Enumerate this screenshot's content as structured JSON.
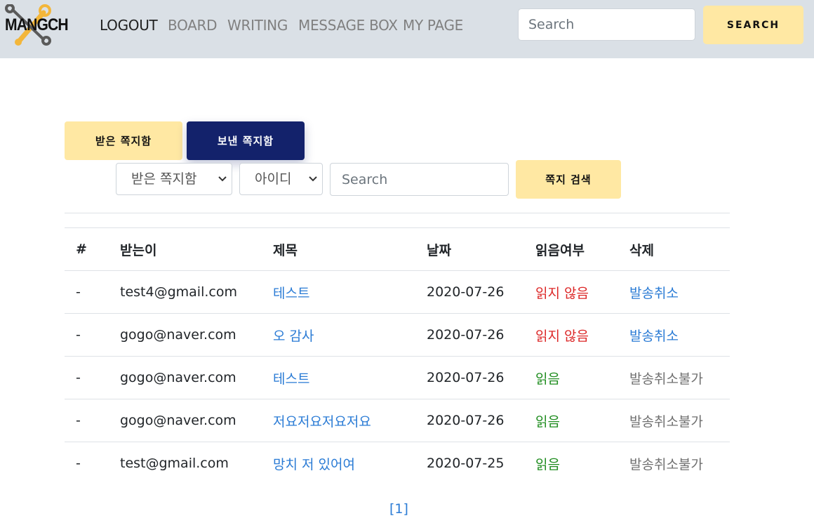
{
  "brand": {
    "logo_text": "MANGCH"
  },
  "nav": {
    "links": [
      {
        "label": "LOGOUT"
      },
      {
        "label": "BOARD"
      },
      {
        "label": "WRITING"
      },
      {
        "label": "MESSAGE BOX"
      },
      {
        "label": "MY PAGE"
      }
    ],
    "search_placeholder": "Search",
    "search_button": "SEARCH"
  },
  "tabs": {
    "received": "받은 쪽지함",
    "sent": "보낸 쪽지함"
  },
  "filter": {
    "box_select": "받은 쪽지함",
    "field_select": "아이디",
    "search_placeholder": "Search",
    "search_button": "쪽지 검색"
  },
  "table": {
    "headers": {
      "index": "#",
      "recipient": "받는이",
      "title": "제목",
      "date": "날짜",
      "read": "읽음여부",
      "delete": "삭제"
    },
    "rows": [
      {
        "index": "-",
        "recipient": "test4@gmail.com",
        "title": "테스트",
        "date": "2020-07-26",
        "read": "읽지 않음",
        "delete": "발송취소"
      },
      {
        "index": "-",
        "recipient": "gogo@naver.com",
        "title": "오 감사",
        "date": "2020-07-26",
        "read": "읽지 않음",
        "delete": "발송취소"
      },
      {
        "index": "-",
        "recipient": "gogo@naver.com",
        "title": "테스트",
        "date": "2020-07-26",
        "read": "읽음",
        "delete": "발송취소불가"
      },
      {
        "index": "-",
        "recipient": "gogo@naver.com",
        "title": "저요저요저요저요",
        "date": "2020-07-26",
        "read": "읽음",
        "delete": "발송취소불가"
      },
      {
        "index": "-",
        "recipient": "test@gmail.com",
        "title": "망치 저 있어여",
        "date": "2020-07-25",
        "read": "읽음",
        "delete": "발송취소불가"
      }
    ]
  },
  "pagination": {
    "current": "[1]"
  },
  "colors": {
    "nav_bg": "#dae0e6",
    "accent_yellow": "#ffe8a3",
    "navy": "#13226b",
    "link": "#2a7bd5",
    "unread": "#dc2626",
    "read": "#1e8c1e"
  }
}
